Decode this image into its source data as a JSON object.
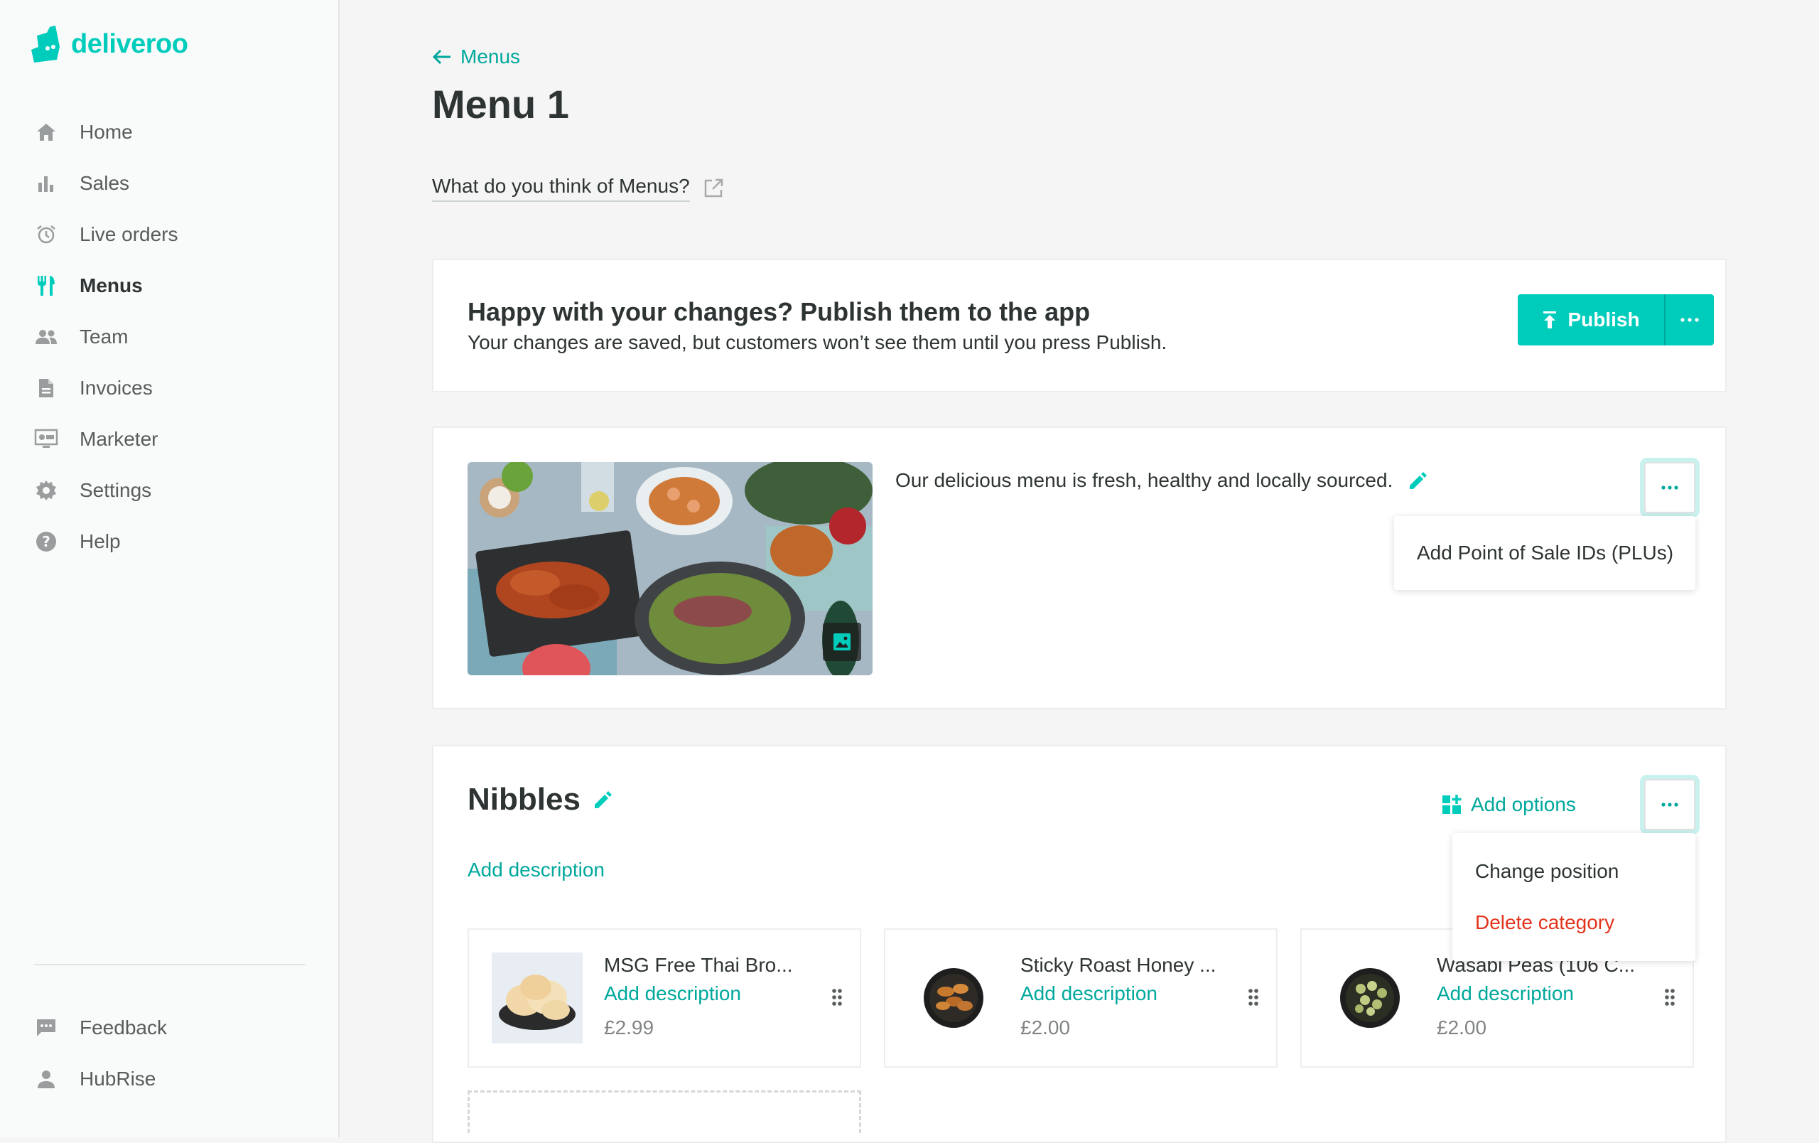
{
  "brand": {
    "name": "deliveroo",
    "accent": "#00ccbc",
    "accent_dark": "#00a89c",
    "danger": "#e2341d"
  },
  "sidebar": {
    "items": [
      {
        "label": "Home",
        "icon": "home-icon"
      },
      {
        "label": "Sales",
        "icon": "bar-chart-icon"
      },
      {
        "label": "Live orders",
        "icon": "alarm-clock-icon"
      },
      {
        "label": "Menus",
        "icon": "fork-knife-icon",
        "active": true
      },
      {
        "label": "Team",
        "icon": "people-icon"
      },
      {
        "label": "Invoices",
        "icon": "document-icon"
      },
      {
        "label": "Marketer",
        "icon": "monitor-icon"
      },
      {
        "label": "Settings",
        "icon": "gear-icon"
      },
      {
        "label": "Help",
        "icon": "help-icon"
      }
    ],
    "bottom_items": [
      {
        "label": "Feedback",
        "icon": "chat-icon"
      },
      {
        "label": "HubRise",
        "icon": "person-icon"
      }
    ]
  },
  "header": {
    "back_label": "Menus",
    "title": "Menu 1",
    "feedback_link": "What do you think of Menus?"
  },
  "publish": {
    "title": "Happy with your changes? Publish them to the app",
    "subtitle": "Your changes are saved, but customers won’t see them until you press Publish.",
    "button_label": "Publish"
  },
  "menu_info": {
    "description": "Our delicious menu is fresh, healthy and locally sourced.",
    "dropdown_items": [
      "Add Point of Sale IDs (PLUs)"
    ]
  },
  "category": {
    "name": "Nibbles",
    "add_description": "Add description",
    "add_options": "Add options",
    "dropdown_items": [
      {
        "label": "Change position",
        "danger": false
      },
      {
        "label": "Delete category",
        "danger": true
      }
    ],
    "items": [
      {
        "name": "MSG Free Thai Bro...",
        "add_description": "Add description",
        "price": "£2.99"
      },
      {
        "name": "Sticky Roast Honey ...",
        "add_description": "Add description",
        "price": "£2.00"
      },
      {
        "name": "Wasabi Peas (106 C...",
        "add_description": "Add description",
        "price": "£2.00"
      }
    ]
  }
}
